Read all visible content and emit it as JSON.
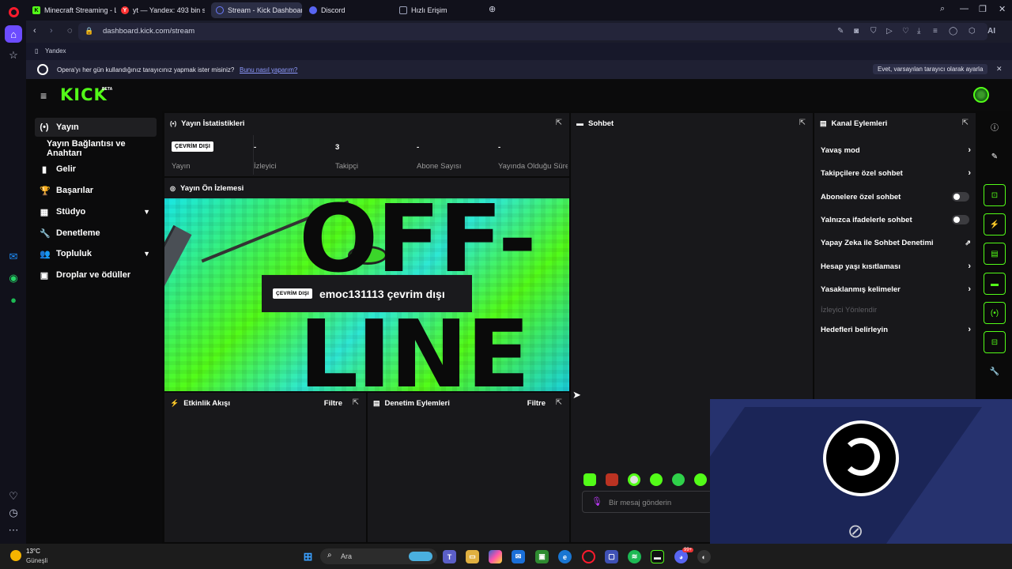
{
  "browser": {
    "tabs": [
      {
        "label": "Minecraft Streaming - Live",
        "fav": "K",
        "favcolor": "#53fc18"
      },
      {
        "label": "yt — Yandex: 493 bin sonuç",
        "fav": "Y",
        "favcolor": "#ff3333"
      },
      {
        "label": "Stream - Kick Dashboard",
        "fav": "",
        "favcolor": "#6b7bff"
      },
      {
        "label": "Discord",
        "fav": "",
        "favcolor": "#5865f2"
      },
      {
        "label": "Hızlı Erişim",
        "fav": "",
        "favcolor": "#9aa0b8"
      }
    ],
    "url": "dashboard.kick.com/stream",
    "ai_label": "AI",
    "bookmark": "Yandex",
    "notice_text": "Opera'yı her gün kullandığınız tarayıcınız yapmak ister misiniz?",
    "notice_link": "Bunu nasıl yaparım?",
    "notice_button": "Evet, varsayılan tarayıcı olarak ayarla"
  },
  "kick": {
    "logo": "KICK",
    "logo_beta": "BETA",
    "sidebar": [
      {
        "label": "Yayın",
        "icon": "(•)"
      },
      {
        "label": "Yayın Bağlantısı ve Anahtarı",
        "icon": ""
      },
      {
        "label": "Gelir",
        "icon": "▮"
      },
      {
        "label": "Başarılar",
        "icon": "🏆"
      },
      {
        "label": "Stüdyo",
        "icon": "▦"
      },
      {
        "label": "Denetleme",
        "icon": "🔧"
      },
      {
        "label": "Topluluk",
        "icon": "👥"
      },
      {
        "label": "Droplar ve ödüller",
        "icon": "▣"
      }
    ],
    "stats": {
      "title": "Yayın İstatistikleri",
      "items": [
        {
          "value": "ÇEVRİM DIŞI",
          "label": "Yayın"
        },
        {
          "value": "-",
          "label": "İzleyici"
        },
        {
          "value": "3",
          "label": "Takipçi"
        },
        {
          "value": "-",
          "label": "Abone Sayısı"
        },
        {
          "value": "-",
          "label": "Yayında Olduğu Süre"
        }
      ]
    },
    "preview": {
      "title": "Yayın Ön İzlemesi",
      "offline_word_top": "OFF-",
      "offline_word_bottom": "LINE",
      "badge": "ÇEVRİM DIŞI",
      "channel_status": "emoc131113 çevrim dışı"
    },
    "activity": {
      "title": "Etkinlik Akışı",
      "filter": "Filtre"
    },
    "moderation": {
      "title": "Denetim Eylemleri",
      "filter": "Filtre"
    },
    "chat": {
      "title": "Sohbet",
      "placeholder": "Bir mesaj gönderin"
    },
    "channel_actions": {
      "title": "Kanal Eylemleri",
      "items": [
        {
          "label": "Yavaş mod",
          "control": "arrow"
        },
        {
          "label": "Takipçilere özel sohbet",
          "control": "arrow"
        },
        {
          "label": "Abonelere özel sohbet",
          "control": "toggle"
        },
        {
          "label": "Yalnızca ifadelerle sohbet",
          "control": "toggle"
        },
        {
          "label": "Yapay Zeka ile Sohbet Denetimi",
          "control": "external"
        },
        {
          "label": "Hesap yaşı kısıtlaması",
          "control": "arrow"
        },
        {
          "label": "Yasaklanmış kelimeler",
          "control": "arrow"
        }
      ],
      "section": "İzleyici Yönlendir",
      "goals": "Hedefleri belirleyin"
    }
  },
  "taskbar": {
    "temp": "13°C",
    "weather": "Güneşli",
    "search": "Ara",
    "discord_badge": "99+"
  },
  "colors": {
    "accent": "#53fc18",
    "panel": "#18181b",
    "obs": "#26326e"
  }
}
